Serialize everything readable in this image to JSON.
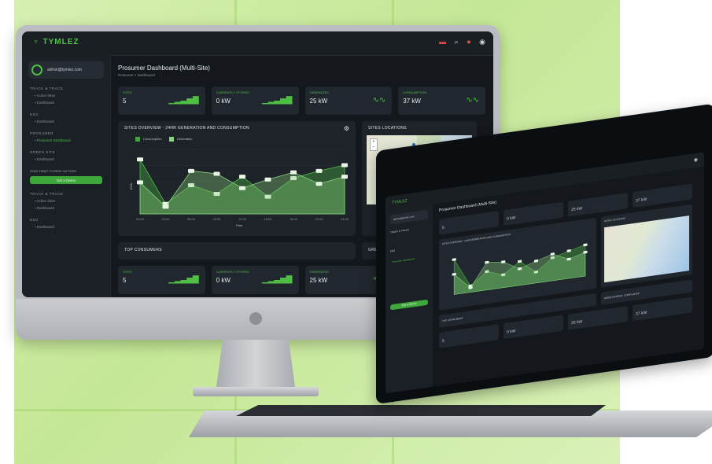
{
  "brand": {
    "name": "TYMLEZ"
  },
  "page": {
    "title": "Prosumer Dashboard (Multi-Site)",
    "breadcrumb": "Prosumer  >  Dashboard"
  },
  "user": {
    "email": "admin@tymlez.com"
  },
  "sidebar": {
    "sections": [
      {
        "title": "TRACK & TRACE",
        "items": [
          "Active Sites",
          "Dashboard"
        ]
      },
      {
        "title": "ESG",
        "items": [
          "Dashboard"
        ]
      },
      {
        "title": "PROSUMER",
        "items": [
          "Prosumer Dashboard"
        ]
      },
      {
        "title": "GREEN SITE",
        "items": [
          "Dashboard"
        ]
      }
    ],
    "hint": "Have Help? Contact our team",
    "button_label": "Get a Demo",
    "extra_sections": [
      {
        "title": "TRACK & TRACE",
        "items": [
          "Active Sites",
          "Dashboard"
        ]
      },
      {
        "title": "ESG",
        "items": [
          "Dashboard"
        ]
      }
    ]
  },
  "kpis_top": [
    {
      "label": "SITES",
      "value": "5",
      "icon": "bars-icon"
    },
    {
      "label": "CURRENTLY STORED",
      "value": "0 kW",
      "icon": "bars-icon"
    },
    {
      "label": "GENERATED",
      "value": "25 kW",
      "icon": "wave-icon"
    },
    {
      "label": "CONSUMPTION",
      "value": "37 kW",
      "icon": "wave-icon"
    }
  ],
  "chart_panel": {
    "title": "SITES OVERVIEW - 24HR GENERATION AND CONSUMPTION"
  },
  "map_panel": {
    "title": "SITES LOCATIONS"
  },
  "lower": {
    "top_consumers": "TOP CONSUMERS",
    "green_compliance": "GREEN ENERGY COMPLIANCE"
  },
  "kpis_bottom": [
    {
      "label": "SITES",
      "value": "5",
      "icon": "bars-icon"
    },
    {
      "label": "CURRENTLY STORED",
      "value": "0 kW",
      "icon": "bars-icon"
    },
    {
      "label": "GENERATED",
      "value": "25 kW",
      "icon": "wave-icon"
    },
    {
      "label": "CONSUMPTION",
      "value": "37 kW",
      "icon": "wave-icon"
    }
  ],
  "chart_data": {
    "type": "area",
    "x": [
      "00:00",
      "03:00",
      "06:00",
      "09:00",
      "12:00",
      "15:00",
      "18:00",
      "21:00",
      "24:00"
    ],
    "series": [
      {
        "name": "Consumption",
        "values": [
          38,
          7,
          20,
          14,
          26,
          12,
          25,
          30,
          34
        ]
      },
      {
        "name": "Generation",
        "values": [
          22,
          5,
          30,
          28,
          18,
          24,
          29,
          21,
          26
        ]
      }
    ],
    "xlabel": "Time",
    "ylabel": "kWh",
    "ylim": [
      0,
      45
    ],
    "grid": true
  },
  "colors": {
    "accent": "#4fbf44",
    "bg": "#14181c",
    "panel": "#1d2329"
  }
}
